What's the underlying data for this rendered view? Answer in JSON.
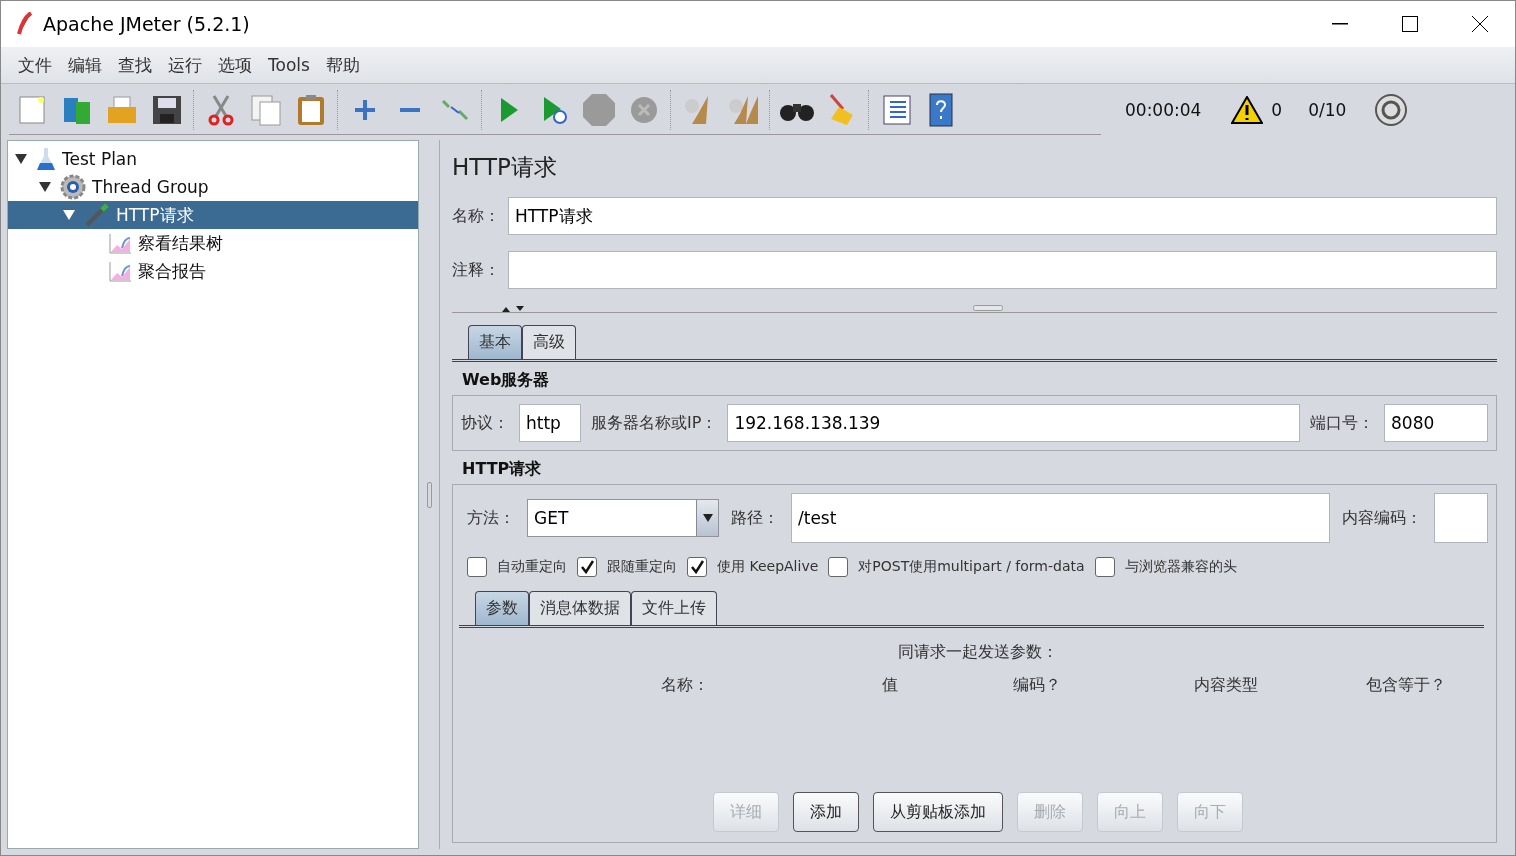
{
  "window": {
    "title": "Apache JMeter (5.2.1)"
  },
  "menu": [
    {
      "label": "文件"
    },
    {
      "label": "编辑"
    },
    {
      "label": "查找"
    },
    {
      "label": "运行"
    },
    {
      "label": "选项"
    },
    {
      "label": "Tools"
    },
    {
      "label": "帮助"
    }
  ],
  "status": {
    "timer": "00:00:04",
    "warnings": "0",
    "threads": "0/10"
  },
  "tree": [
    {
      "label": "Test Plan",
      "kind": "plan",
      "expanded": true,
      "selected": false,
      "children": [
        {
          "label": "Thread Group",
          "kind": "thread",
          "expanded": true,
          "selected": false,
          "children": [
            {
              "label": "HTTP请求",
              "kind": "sampler",
              "expanded": true,
              "selected": true,
              "children": [
                {
                  "label": "察看结果树",
                  "kind": "listener",
                  "selected": false
                },
                {
                  "label": "聚合报告",
                  "kind": "listener",
                  "selected": false
                }
              ]
            }
          ]
        }
      ]
    }
  ],
  "panel": {
    "title": "HTTP请求",
    "name_label": "名称：",
    "name_value": "HTTP请求",
    "comment_label": "注释："
  },
  "tabs": [
    {
      "label": "基本",
      "selected": true
    },
    {
      "label": "高级",
      "selected": false
    }
  ],
  "web_server": {
    "title": "Web服务器",
    "protocol_label": "协议：",
    "protocol": "http",
    "server_label": "服务器名称或IP：",
    "server": "192.168.138.139",
    "port_label": "端口号：",
    "port": "8080"
  },
  "http_request": {
    "title": "HTTP请求",
    "method_label": "方法：",
    "method": "GET",
    "path_label": "路径：",
    "path": "/test",
    "encoding_label": "内容编码："
  },
  "options": [
    {
      "label": "自动重定向",
      "checked": false
    },
    {
      "label": "跟随重定向",
      "checked": true
    },
    {
      "label": "使用 KeepAlive",
      "checked": true
    },
    {
      "label": "对POST使用multipart / form-data",
      "checked": false
    },
    {
      "label": "与浏览器兼容的头",
      "checked": false
    }
  ],
  "sub_tabs": [
    {
      "label": "参数",
      "selected": true
    },
    {
      "label": "消息体数据",
      "selected": false
    },
    {
      "label": "文件上传",
      "selected": false
    }
  ],
  "params": {
    "caption": "同请求一起发送参数：",
    "columns": [
      "名称：",
      "值",
      "编码？",
      "内容类型",
      "包含等于？"
    ]
  },
  "buttons": [
    {
      "label": "详细",
      "disabled": true
    },
    {
      "label": "添加",
      "disabled": false
    },
    {
      "label": "从剪贴板添加",
      "disabled": false
    },
    {
      "label": "删除",
      "disabled": true
    },
    {
      "label": "向上",
      "disabled": true
    },
    {
      "label": "向下",
      "disabled": true
    }
  ]
}
